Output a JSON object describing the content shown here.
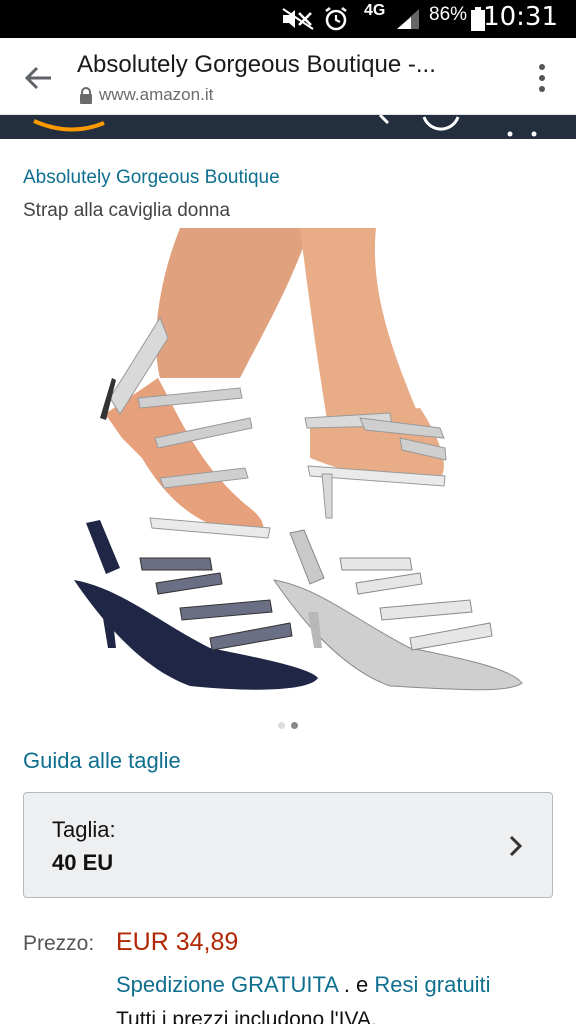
{
  "status_bar": {
    "signal": "4G",
    "battery": "86%",
    "time": "10:31",
    "icons": [
      "mute-icon",
      "alarm-icon",
      "signal-icon",
      "battery-icon"
    ]
  },
  "toolbar": {
    "title": "Absolutely Gorgeous Boutique -...",
    "url": "www.amazon.it"
  },
  "product": {
    "brand": "Absolutely Gorgeous Boutique",
    "title": "Strap alla caviglia donna",
    "image_alt": "sandals-photo",
    "carousel_pages": 2,
    "carousel_active": 2,
    "size_guide": "Guida alle taglie",
    "size_label": "Taglia:",
    "size_value": "40 EU",
    "price_label": "Prezzo:",
    "price": "EUR 34,89",
    "shipping": "Spedizione GRATUITA",
    "shipping_sep": " . e ",
    "returns": "Resi gratuiti",
    "vat": "Tutti i prezzi includono l'IVA."
  },
  "colors": {
    "link": "#0f6f8f",
    "price": "#b12704",
    "amazon_header": "#232f3e",
    "status_bar": "#000000"
  }
}
